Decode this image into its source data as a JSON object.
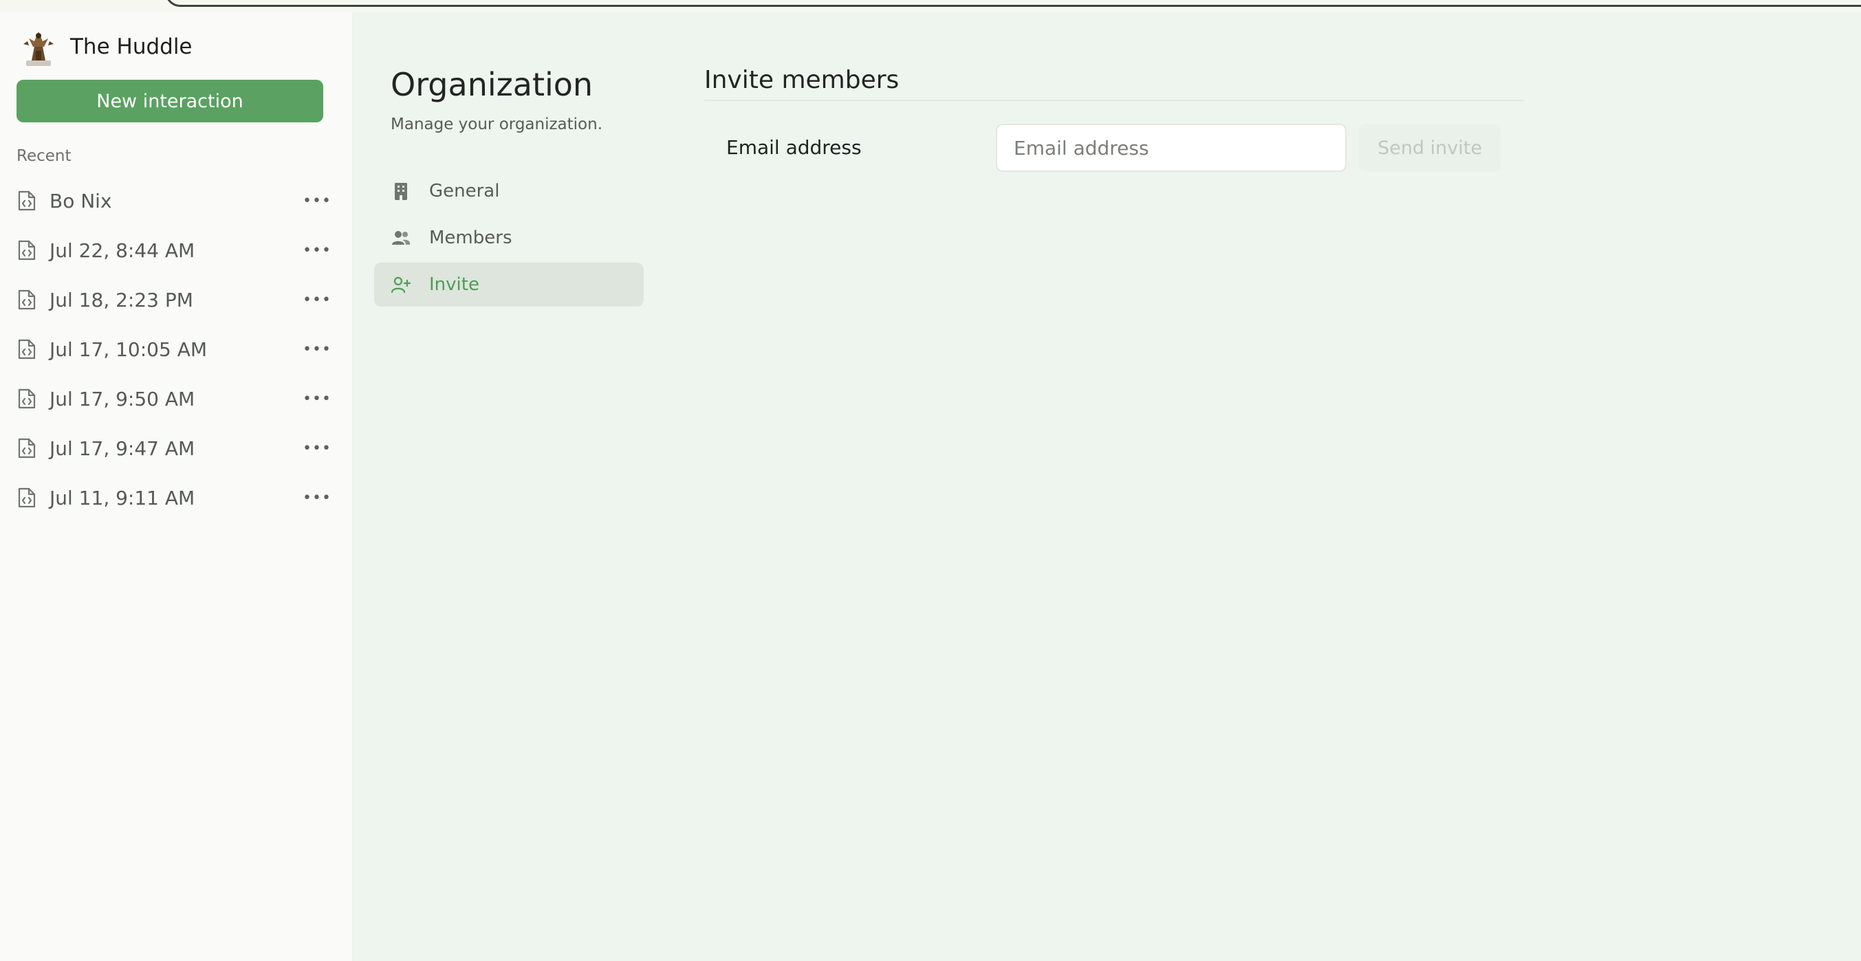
{
  "brand": {
    "name": "The Huddle",
    "logo_icon": "huddle-logo-icon"
  },
  "sidebar": {
    "new_button_label": "New interaction",
    "recent_label": "Recent",
    "recent_items": [
      {
        "label": "Bo Nix",
        "icon": "file-code-icon",
        "more_icon": "more-horizontal-icon"
      },
      {
        "label": "Jul 22, 8:44 AM",
        "icon": "file-code-icon",
        "more_icon": "more-horizontal-icon"
      },
      {
        "label": "Jul 18, 2:23 PM",
        "icon": "file-code-icon",
        "more_icon": "more-horizontal-icon"
      },
      {
        "label": "Jul 17, 10:05 AM",
        "icon": "file-code-icon",
        "more_icon": "more-horizontal-icon"
      },
      {
        "label": "Jul 17, 9:50 AM",
        "icon": "file-code-icon",
        "more_icon": "more-horizontal-icon"
      },
      {
        "label": "Jul 17, 9:47 AM",
        "icon": "file-code-icon",
        "more_icon": "more-horizontal-icon"
      },
      {
        "label": "Jul 11, 9:11 AM",
        "icon": "file-code-icon",
        "more_icon": "more-horizontal-icon"
      }
    ]
  },
  "settings": {
    "title": "Organization",
    "subtitle": "Manage your organization.",
    "nav": [
      {
        "label": "General",
        "icon": "building-icon",
        "active": false
      },
      {
        "label": "Members",
        "icon": "users-icon",
        "active": false
      },
      {
        "label": "Invite",
        "icon": "user-plus-icon",
        "active": true
      }
    ]
  },
  "invite": {
    "title": "Invite members",
    "field_label": "Email address",
    "input_value": "",
    "input_placeholder": "Email address",
    "send_label": "Send invite"
  },
  "colors": {
    "accent": "#5aa162",
    "accent_text": "#4f9a57",
    "background": "#eef5ee",
    "sidebar_bg": "#fafaf9",
    "active_nav_bg": "#dde5dd",
    "disabled_button_bg": "#eaf0ea",
    "disabled_button_text": "#c2c6c2"
  }
}
